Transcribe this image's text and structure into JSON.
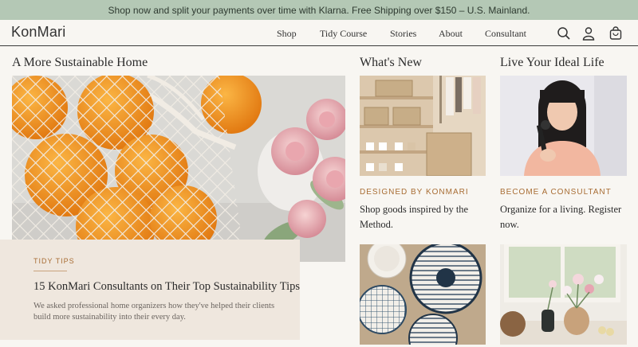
{
  "promo_bar": {
    "text": "Shop now and split your payments over time with Klarna. Free Shipping over $150 – U.S. Mainland."
  },
  "header": {
    "logo": "KonMari",
    "nav": [
      "Shop",
      "Tidy Course",
      "Stories",
      "About",
      "Consultant"
    ],
    "icons": [
      "search-icon",
      "account-icon",
      "bag-icon"
    ]
  },
  "sections": {
    "sustainable": {
      "heading": "A More Sustainable Home",
      "card": {
        "tag": "TIDY TIPS",
        "title": "15 KonMari Consultants on Their Top Sustainability Tips",
        "description": "We asked professional home organizers how they've helped their clients build more sustainability into their every day."
      }
    },
    "whats_new": {
      "heading": "What's New",
      "eyebrow": "DESIGNED BY KONMARI",
      "blurb": "Shop goods inspired by the Method."
    },
    "ideal_life": {
      "heading": "Live Your Ideal Life",
      "eyebrow": "BECOME A CONSULTANT",
      "blurb": "Organize for a living. Register now."
    }
  },
  "colors": {
    "promo_bg": "#b4c8b5",
    "accent": "#a86d34",
    "page_bg": "#f8f6f2",
    "card_bg": "#efe7de"
  }
}
